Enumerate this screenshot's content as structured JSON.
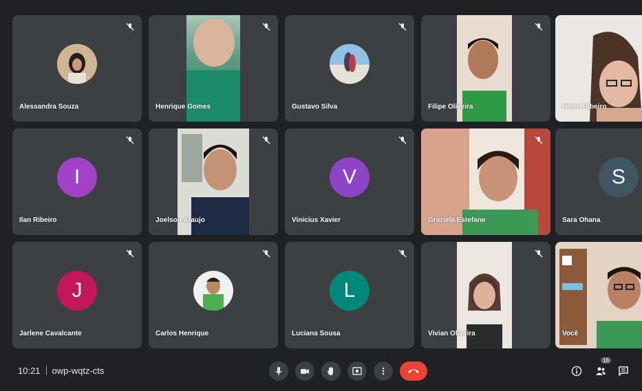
{
  "participants": [
    {
      "name": "Alessandra Souza",
      "type": "photo",
      "muted": true
    },
    {
      "name": "Henrique Gomes",
      "type": "video",
      "muted": true
    },
    {
      "name": "Gustavo Silva",
      "type": "photo",
      "muted": true
    },
    {
      "name": "Filipe Oliveira",
      "type": "video",
      "muted": true
    },
    {
      "name": "Helen Ribeiro",
      "type": "video",
      "muted": false
    },
    {
      "name": "Ilan Ribeiro",
      "type": "initial",
      "initial": "I",
      "color": "#a142c8",
      "muted": true
    },
    {
      "name": "Joelson Araujo",
      "type": "video",
      "muted": true
    },
    {
      "name": "Vinicius Xavier",
      "type": "initial",
      "initial": "V",
      "color": "#8e44c7",
      "muted": true
    },
    {
      "name": "Graziela Estefane",
      "type": "video",
      "muted": true
    },
    {
      "name": "Sara Ohana",
      "type": "initial",
      "initial": "S",
      "color": "#3f5663",
      "muted": false
    },
    {
      "name": "Jarlene Cavalcante",
      "type": "initial",
      "initial": "J",
      "color": "#c2185b",
      "muted": true
    },
    {
      "name": "Carlos Henrique",
      "type": "photo",
      "muted": true
    },
    {
      "name": "Luciana Sousa",
      "type": "initial",
      "initial": "L",
      "color": "#00897b",
      "muted": true
    },
    {
      "name": "Vivian Oliveira",
      "type": "video",
      "muted": true
    },
    {
      "name": "Você",
      "type": "video",
      "muted": false,
      "active": true
    }
  ],
  "meeting": {
    "time": "10:21",
    "code": "owp-wqtz-cts"
  },
  "controls": {
    "people_count": "16"
  },
  "colors": {
    "background": "#202124",
    "tile": "#3c4043",
    "end_call": "#ea4335",
    "active_border": "#8ab4f8"
  }
}
